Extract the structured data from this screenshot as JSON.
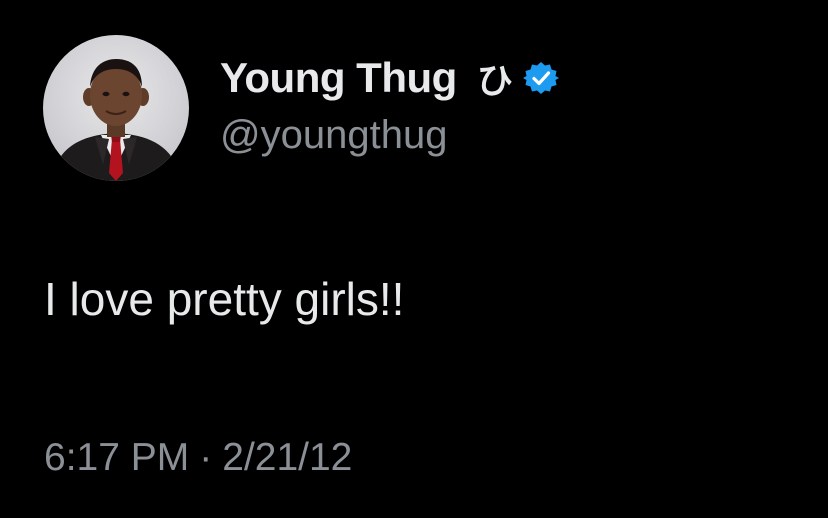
{
  "tweet": {
    "author": {
      "display_name": "Young Thug",
      "name_glyph": "ひ",
      "handle": "@youngthug",
      "verified": true,
      "avatar_icon": "profile-photo-boy-in-suit"
    },
    "text": "I love pretty girls!!",
    "time": "6:17 PM",
    "separator": "·",
    "date": "2/21/12"
  },
  "colors": {
    "background": "#000000",
    "primary_text": "#e7e9ea",
    "secondary_text": "#8b9096",
    "verified_blue": "#1d9bf0"
  }
}
